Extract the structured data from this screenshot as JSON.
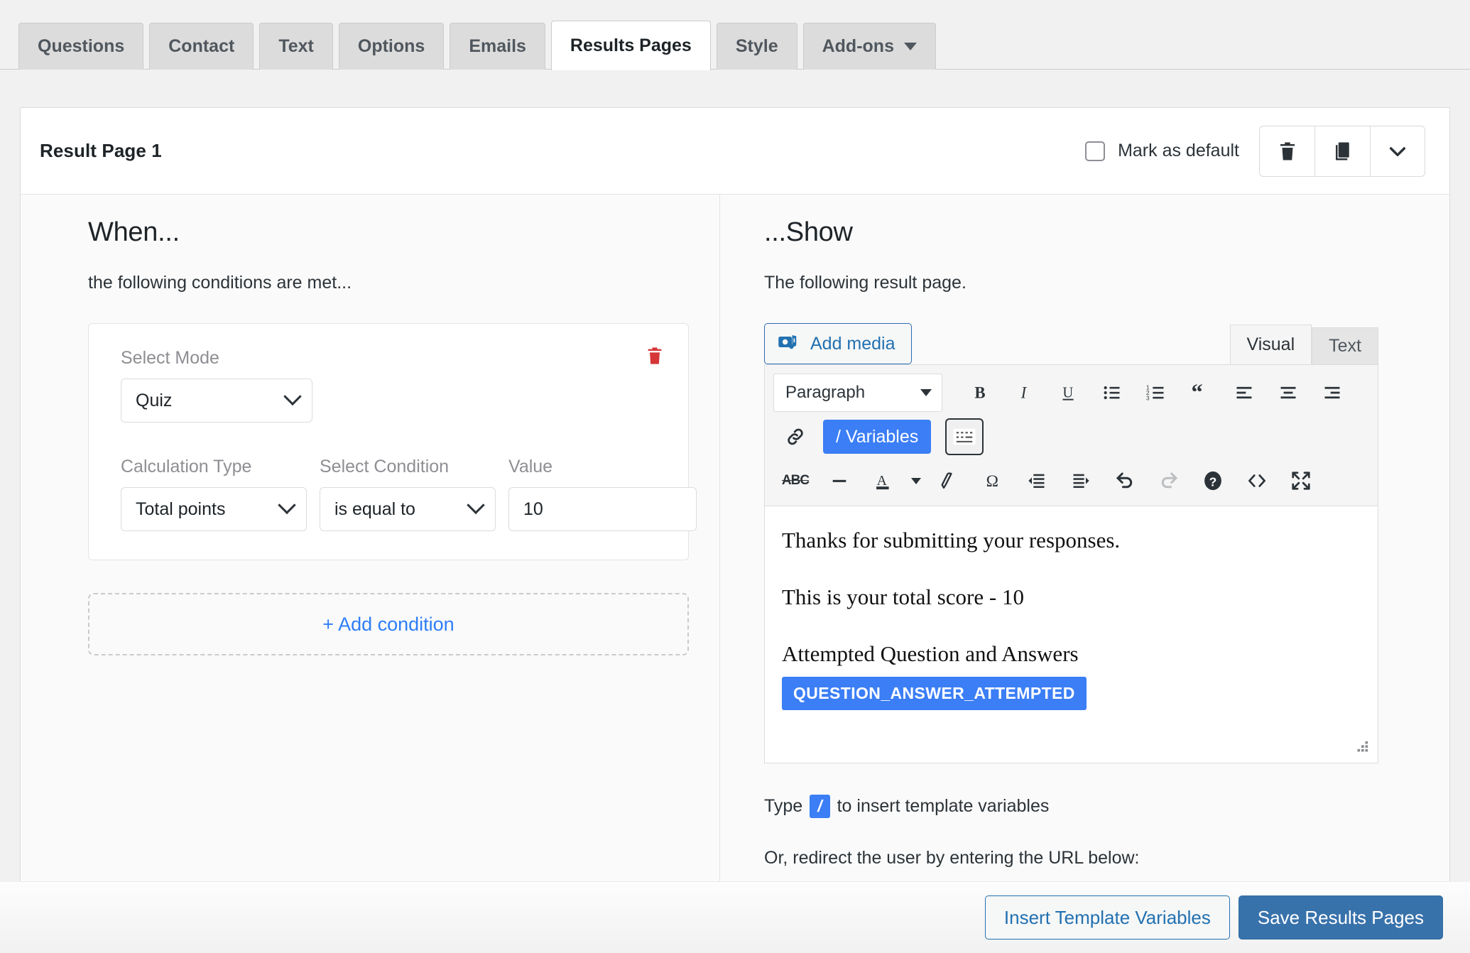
{
  "tabs": [
    {
      "label": "Questions",
      "active": false,
      "caret": false
    },
    {
      "label": "Contact",
      "active": false,
      "caret": false
    },
    {
      "label": "Text",
      "active": false,
      "caret": false
    },
    {
      "label": "Options",
      "active": false,
      "caret": false
    },
    {
      "label": "Emails",
      "active": false,
      "caret": false
    },
    {
      "label": "Results Pages",
      "active": true,
      "caret": false
    },
    {
      "label": "Style",
      "active": false,
      "caret": false
    },
    {
      "label": "Add-ons",
      "active": false,
      "caret": true
    }
  ],
  "card": {
    "title": "Result Page 1",
    "mark_default_label": "Mark as default",
    "mark_default_checked": false,
    "actions": [
      {
        "icon": "trash-icon",
        "name": "delete-result-page-button"
      },
      {
        "icon": "copy-icon",
        "name": "duplicate-result-page-button"
      },
      {
        "icon": "chevron-down-icon",
        "name": "collapse-result-page-button"
      }
    ]
  },
  "when": {
    "heading": "When...",
    "subtitle": "the following conditions are met...",
    "condition": {
      "select_mode_label": "Select Mode",
      "select_mode_value": "Quiz",
      "calculation_type_label": "Calculation Type",
      "calculation_type_value": "Total points",
      "select_condition_label": "Select Condition",
      "select_condition_value": "is equal to",
      "value_label": "Value",
      "value_value": "10"
    },
    "add_condition_label": "+ Add condition"
  },
  "show": {
    "heading": "...Show",
    "subtitle": "The following result page.",
    "add_media_label": "Add media",
    "editor_tabs": [
      {
        "label": "Visual",
        "active": true
      },
      {
        "label": "Text",
        "active": false
      }
    ],
    "toolbar": {
      "format_select_value": "Paragraph",
      "variables_button_label": "/ Variables",
      "row1_icons": [
        "bold-icon",
        "italic-icon",
        "underline-icon",
        "bulleted-list-icon",
        "numbered-list-icon",
        "blockquote-icon",
        "align-left-icon",
        "align-center-icon",
        "align-right-icon"
      ],
      "row2_icons": [
        "link-icon",
        "keyboard-shortcuts-icon"
      ],
      "row3_icons": [
        "strikethrough-icon",
        "horizontal-rule-icon",
        "text-color-icon",
        "clear-formatting-icon",
        "special-character-icon",
        "outdent-icon",
        "indent-icon",
        "undo-icon",
        "redo-icon",
        "help-icon",
        "source-code-icon",
        "fullscreen-icon"
      ]
    },
    "content": {
      "line1": "Thanks for submitting your responses.",
      "line2": "This is your total score - 10",
      "line3": "Attempted Question and Answers",
      "variable_chip": "QUESTION_ANSWER_ATTEMPTED"
    },
    "hint_prefix": "Type",
    "hint_slash": "/",
    "hint_suffix": "to insert template variables",
    "redirect_hint": "Or, redirect the user by entering the URL below:"
  },
  "footer": {
    "insert_template_variables_label": "Insert Template Variables",
    "save_label": "Save Results Pages"
  },
  "colors": {
    "accent_blue": "#3b7ef5",
    "link_blue": "#2271b1",
    "primary_button": "#3872ab",
    "danger_red": "#d63638",
    "page_bg": "#f1f1f1"
  }
}
